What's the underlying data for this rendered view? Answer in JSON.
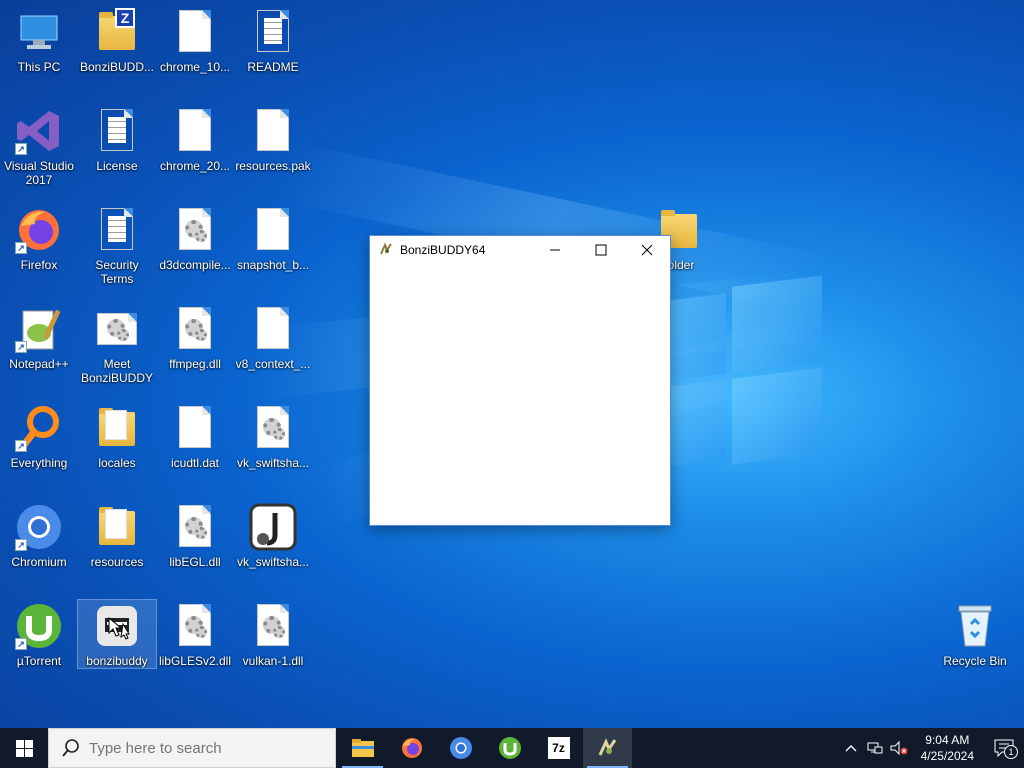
{
  "desktop": {
    "icons": [
      {
        "label": "This PC"
      },
      {
        "label": "BonziBUDD..."
      },
      {
        "label": "chrome_10..."
      },
      {
        "label": "README"
      },
      {
        "label": "Visual Studio 2017"
      },
      {
        "label": "License"
      },
      {
        "label": "chrome_20..."
      },
      {
        "label": "resources.pak"
      },
      {
        "label": "Firefox"
      },
      {
        "label": "Security Terms"
      },
      {
        "label": "d3dcompile..."
      },
      {
        "label": "snapshot_b..."
      },
      {
        "label": "Notepad++"
      },
      {
        "label": "Meet BonziBUDDY"
      },
      {
        "label": "ffmpeg.dll"
      },
      {
        "label": "v8_context_..."
      },
      {
        "label": "Everything"
      },
      {
        "label": "locales"
      },
      {
        "label": "icudtl.dat"
      },
      {
        "label": "vk_swiftsha..."
      },
      {
        "label": "Chromium"
      },
      {
        "label": "resources"
      },
      {
        "label": "libEGL.dll"
      },
      {
        "label": "vk_swiftsha..."
      },
      {
        "label": "µTorrent"
      },
      {
        "label": "bonzibuddy"
      },
      {
        "label": "libGLESv2.dll"
      },
      {
        "label": "vulkan-1.dll"
      },
      {
        "label": "Recycle Bin"
      },
      {
        "label": "older"
      }
    ]
  },
  "window": {
    "title": "BonziBUDDY64",
    "minimize_glyph": "—",
    "maximize_glyph": "☐",
    "close_glyph": "✕"
  },
  "taskbar": {
    "search_placeholder": "Type here to search",
    "apps": [
      {
        "name": "File Explorer"
      },
      {
        "name": "Firefox"
      },
      {
        "name": "Chromium"
      },
      {
        "name": "µTorrent"
      },
      {
        "name": "7-Zip",
        "glyph": "7z"
      },
      {
        "name": "BonziBUDDY64"
      }
    ],
    "time": "9:04 AM",
    "date": "4/25/2024",
    "notification_count": "1"
  },
  "colors": {
    "accent": "#0a64cf",
    "taskbar": "#101a2a"
  }
}
